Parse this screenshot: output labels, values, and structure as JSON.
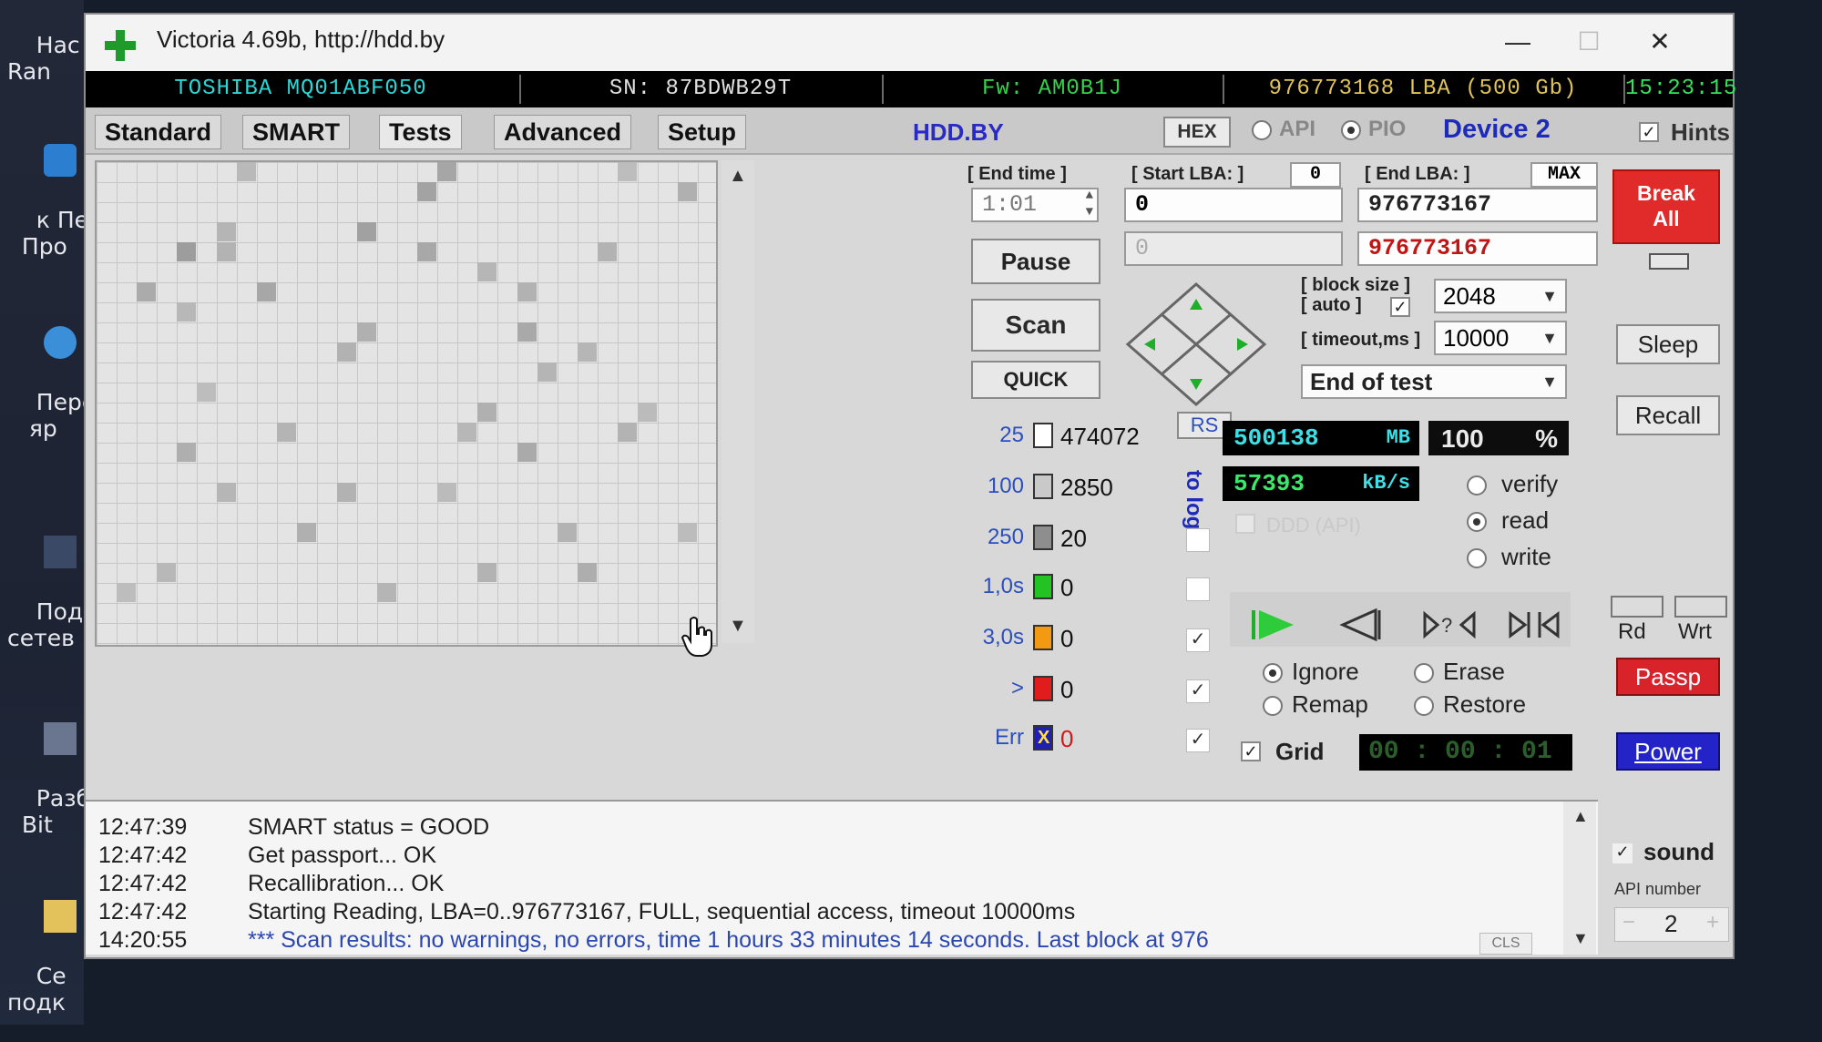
{
  "desktop": {
    "icons": [
      {
        "label": "Нас\nRan"
      },
      {
        "label": "к Пере\n  Про"
      },
      {
        "label": "Пере\n   яр"
      },
      {
        "label": "Подк\nсетев"
      },
      {
        "label": "Разб\n  Bit"
      },
      {
        "label": "Се\nподк"
      }
    ]
  },
  "window": {
    "title": "Victoria 4.69b, http://hdd.by",
    "minimize": "—",
    "maximize": "☐",
    "close": "✕"
  },
  "infobar": {
    "model": "TOSHIBA MQ01ABF050",
    "serial": "SN: 87BDWB29T",
    "firmware": "Fw: AM0B1J",
    "lba": "976773168 LBA (500 Gb)",
    "clock": "15:23:15"
  },
  "tabs": [
    "Standard",
    "SMART",
    "Tests",
    "Advanced",
    "Setup"
  ],
  "active_tab": "Tests",
  "toolbar": {
    "hddby": "HDD.BY",
    "hex": "HEX",
    "api": "API",
    "pio": "PIO",
    "device": "Device 2",
    "hints": "Hints"
  },
  "test": {
    "end_time_label": "[ End time ]",
    "end_time": "1:01",
    "start_lba_label": "[ Start LBA: ]",
    "start_lba_zero": "0",
    "start_lba": "0",
    "start_lba_disabled": "0",
    "end_lba_label": "[ End LBA: ]",
    "max_label": "MAX",
    "end_lba": "976773167",
    "end_lba_current": "976773167",
    "pause_label": "Pause",
    "scan_label": "Scan",
    "quick_label": "QUICK",
    "block_size_label": "[ block size ]",
    "auto_label": "[ auto ]",
    "block_size": "2048",
    "timeout_label": "[ timeout,ms ]",
    "timeout": "10000",
    "end_action": "End of test"
  },
  "legend": {
    "rs": "RS",
    "to_log": "to log:",
    "rows": [
      {
        "time": "25",
        "count": "474072",
        "color": "#ffffff"
      },
      {
        "time": "100",
        "count": "2850",
        "color": "#c9c9c9"
      },
      {
        "time": "250",
        "count": "20",
        "color": "#8e8e8e"
      },
      {
        "time": "1,0s",
        "count": "0",
        "color": "#22c322"
      },
      {
        "time": "3,0s",
        "count": "0",
        "color": "#f39a12"
      },
      {
        "time": ">",
        "count": "0",
        "color": "#e01c1c"
      },
      {
        "time": "Err",
        "count": "0",
        "color": "#1f1fb3"
      }
    ],
    "err_mark": "X"
  },
  "stats": {
    "mb_value": "500138",
    "mb_unit": "MB",
    "percent_value": "100",
    "percent_unit": "%",
    "speed_value": "57393",
    "speed_unit": "kB/s",
    "ddd_label": "DDD (API)",
    "verify": "verify",
    "read": "read",
    "write": "write",
    "ignore": "Ignore",
    "erase": "Erase",
    "remap": "Remap",
    "restore": "Restore",
    "grid_label": "Grid",
    "timer": "00 : 00 : 01"
  },
  "side": {
    "break_all": "Break\nAll",
    "sleep": "Sleep",
    "recall": "Recall",
    "rd": "Rd",
    "wrt": "Wrt",
    "passp": "Passp",
    "power": "Power",
    "sound": "sound",
    "api_number_label": "API number",
    "api_number": "2",
    "api_minus": "−",
    "api_plus": "+"
  },
  "log": {
    "lines": [
      {
        "time": "12:47:39",
        "text": "SMART status = GOOD"
      },
      {
        "time": "12:47:42",
        "text": "Get passport... OK"
      },
      {
        "time": "12:47:42",
        "text": "Recallibration... OK"
      },
      {
        "time": "12:47:42",
        "text": "Starting Reading, LBA=0..976773167, FULL, sequential access, timeout 10000ms"
      },
      {
        "time": "14:20:55",
        "text": "*** Scan results: no warnings, no errors, time 1 hours 33 minutes 14 seconds. Last block at 976"
      }
    ],
    "cls": "CLS"
  },
  "colors": {
    "model": "#2bd7d7",
    "serial": "#e0e0e0",
    "firmware": "#35d24a",
    "lba": "#e0c35a",
    "clock": "#38e060",
    "lcd_green": "#3ae86a",
    "lcd_cyan": "#3ee0e6",
    "break_red": "#e12a2a",
    "power_blue": "#2323c8"
  }
}
